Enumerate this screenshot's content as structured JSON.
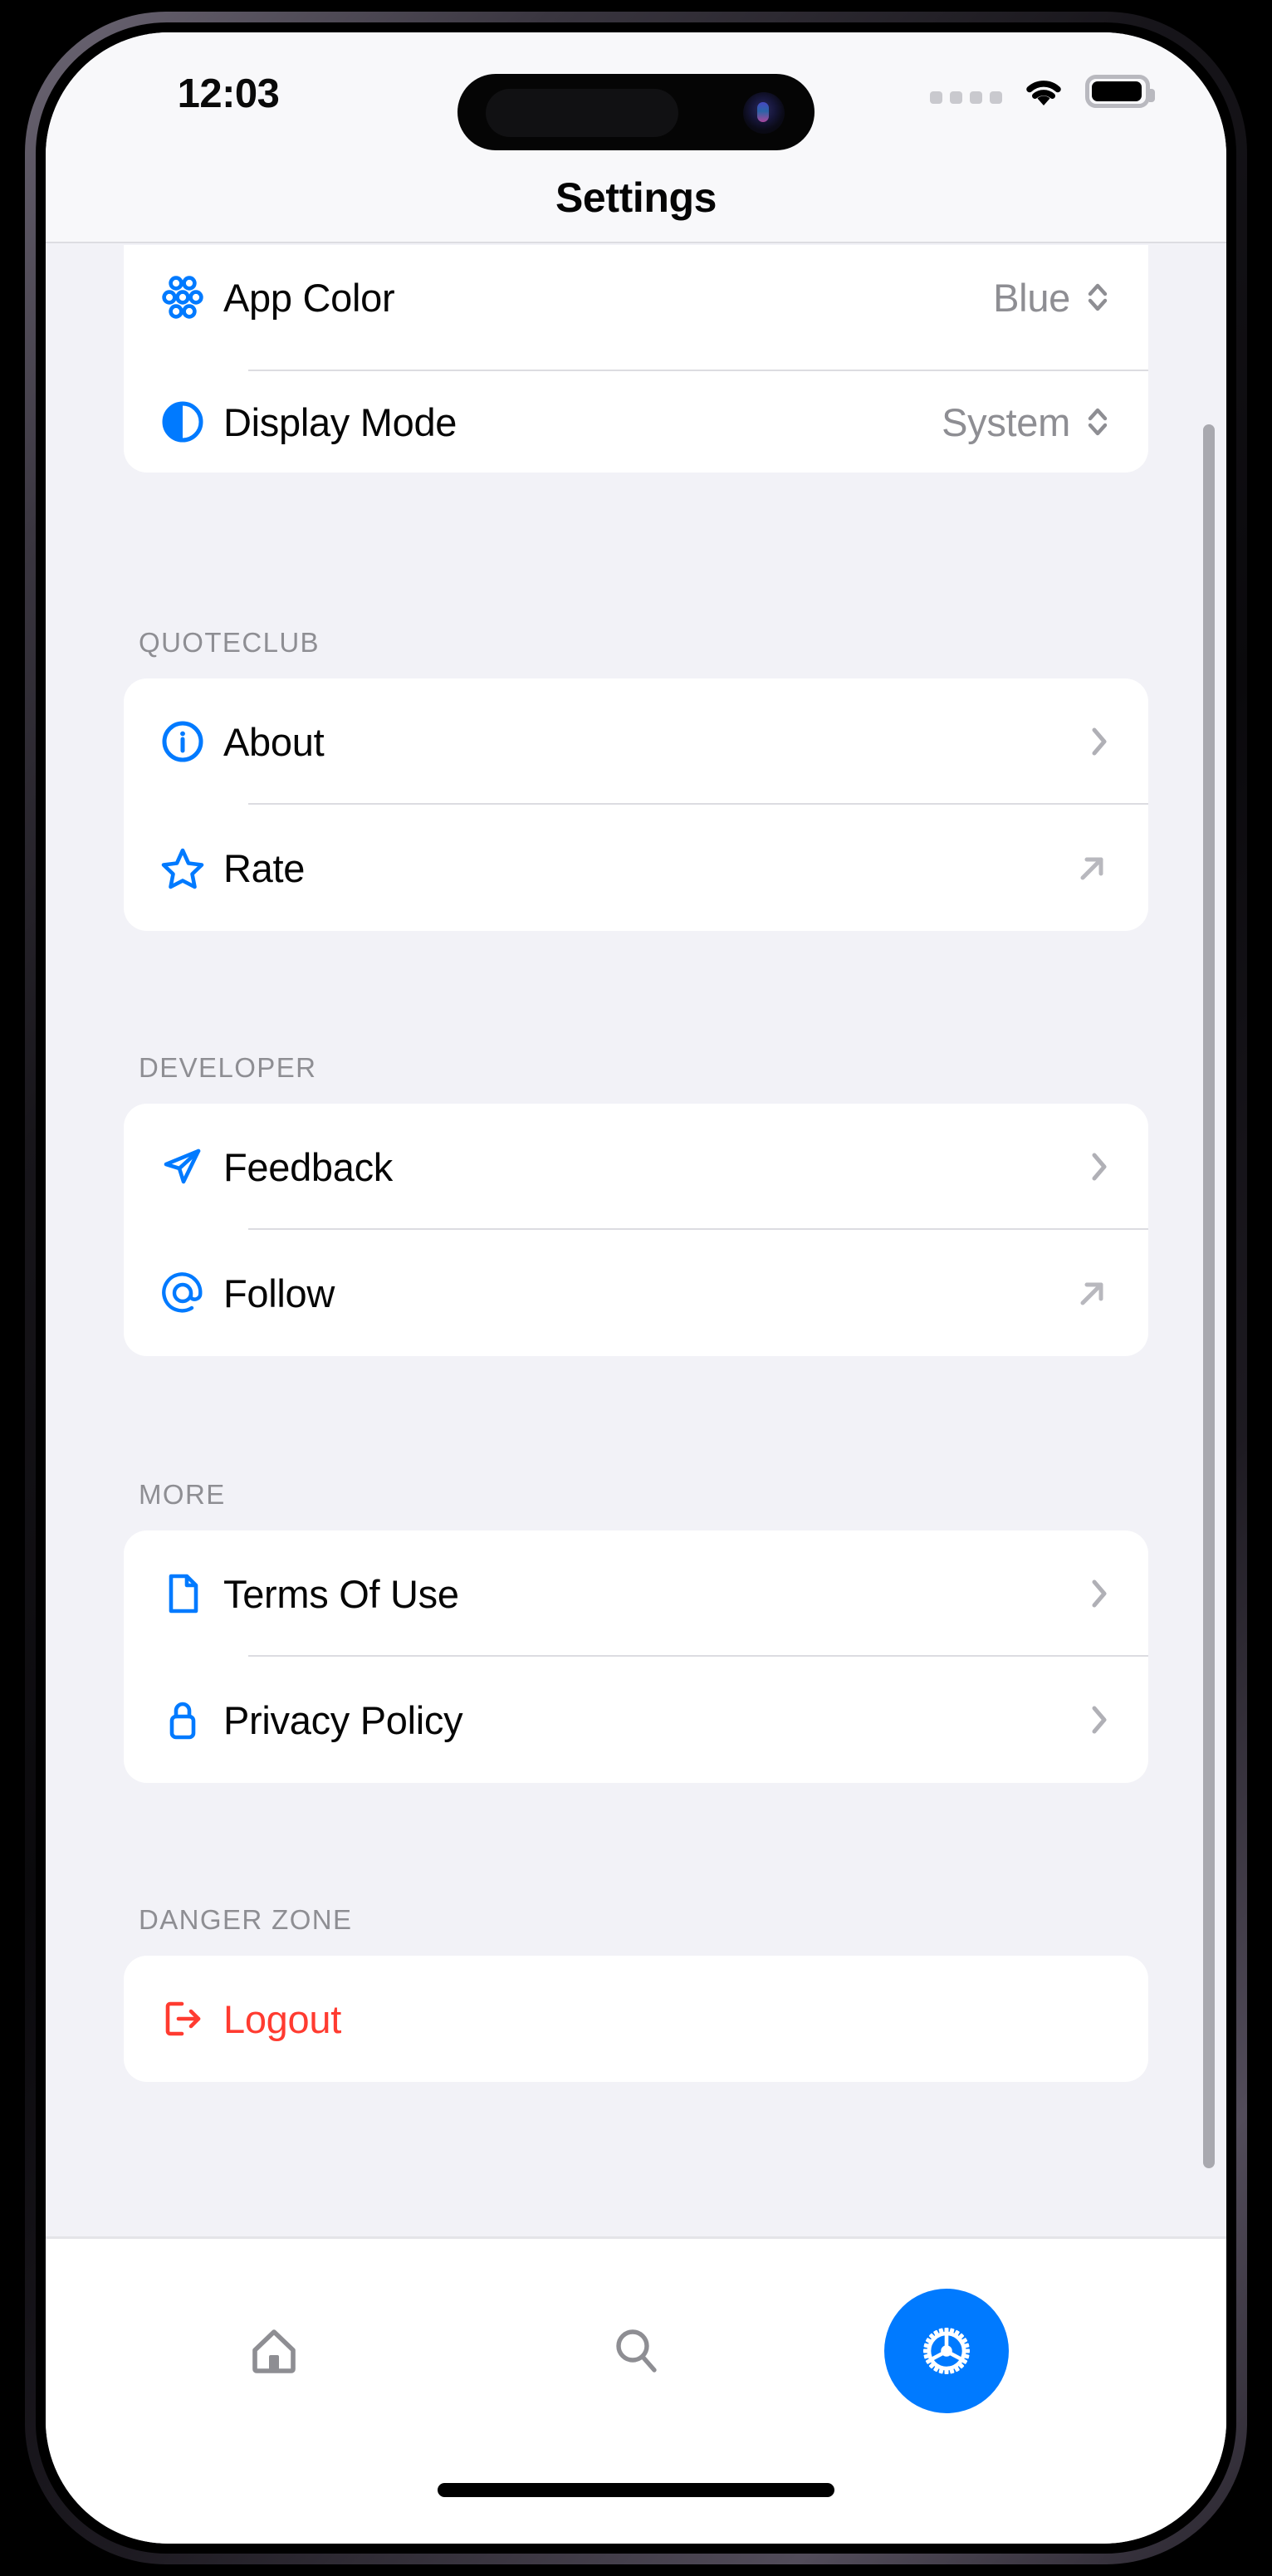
{
  "status_bar": {
    "time": "12:03",
    "cellular_icon": "cellular-dots-icon",
    "wifi_icon": "wifi-icon",
    "battery_icon": "battery-full-icon"
  },
  "header": {
    "title": "Settings"
  },
  "theme": {
    "accent": "#007AFF",
    "danger": "#FF3B30",
    "background": "#F2F2F7",
    "card": "#FFFFFF",
    "secondary_text": "#8E8E93"
  },
  "sections": [
    {
      "header": "",
      "rows": [
        {
          "label": "App Color",
          "icon": "color-palette-circles-icon",
          "value": "Blue",
          "accessory": "updown-chevron-icon"
        },
        {
          "label": "Display Mode",
          "icon": "half-circle-contrast-icon",
          "value": "System",
          "accessory": "updown-chevron-icon"
        }
      ]
    },
    {
      "header": "QUOTECLUB",
      "rows": [
        {
          "label": "About",
          "icon": "info-circle-icon",
          "value": "",
          "accessory": "chevron-right-icon"
        },
        {
          "label": "Rate",
          "icon": "star-icon",
          "value": "",
          "accessory": "external-link-arrow-icon"
        }
      ]
    },
    {
      "header": "DEVELOPER",
      "rows": [
        {
          "label": "Feedback",
          "icon": "paper-plane-icon",
          "value": "",
          "accessory": "chevron-right-icon"
        },
        {
          "label": "Follow",
          "icon": "at-sign-icon",
          "value": "",
          "accessory": "external-link-arrow-icon"
        }
      ]
    },
    {
      "header": "MORE",
      "rows": [
        {
          "label": "Terms Of Use",
          "icon": "document-icon",
          "value": "",
          "accessory": "chevron-right-icon"
        },
        {
          "label": "Privacy Policy",
          "icon": "lock-icon",
          "value": "",
          "accessory": "chevron-right-icon"
        }
      ]
    },
    {
      "header": "DANGER ZONE",
      "rows": [
        {
          "label": "Logout",
          "icon": "logout-arrow-icon",
          "value": "",
          "accessory": ""
        }
      ]
    }
  ],
  "tab_bar": {
    "items": [
      {
        "name": "home",
        "icon": "home-icon",
        "active": false
      },
      {
        "name": "search",
        "icon": "search-icon",
        "active": false
      },
      {
        "name": "settings",
        "icon": "gear-icon",
        "active": true
      }
    ]
  }
}
